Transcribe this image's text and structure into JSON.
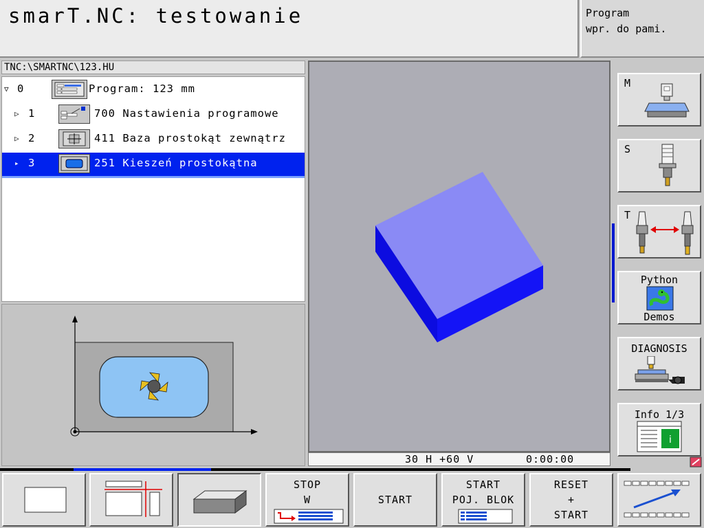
{
  "header": {
    "title": "smarT.NC: testowanie",
    "mode_line1": "Program",
    "mode_line2": "wpr. do pami."
  },
  "tree": {
    "path": "TNC:\\SMARTNC\\123.HU",
    "rows": [
      {
        "num": "0",
        "label": "Program: 123 mm"
      },
      {
        "num": "1",
        "label": "700 Nastawienia programowe"
      },
      {
        "num": "2",
        "label": "411 Baza prostokąt zewnątrz"
      },
      {
        "num": "3",
        "label": "251 Kieszeń prostokątna"
      }
    ],
    "selected_index": 3
  },
  "view": {
    "angle": "30 H +60 V",
    "time": "0:00:00"
  },
  "vertical_softkeys": [
    {
      "key": "M",
      "icon": "machine-table-icon"
    },
    {
      "key": "S",
      "icon": "spindle-icon"
    },
    {
      "key": "T",
      "icon": "tool-change-icon"
    },
    {
      "line1": "Python",
      "line2": "Demos",
      "icon": "python-icon"
    },
    {
      "line1": "DIAGNOSIS",
      "icon": "diagnosis-icon"
    },
    {
      "line1": "Info 1/3",
      "icon": "info-icon"
    }
  ],
  "horizontal_softkeys": [
    {
      "icon": "blank-view-icon"
    },
    {
      "icon": "split-view-icon"
    },
    {
      "icon": "3d-block-icon"
    },
    {
      "line1": "STOP",
      "line2": "W",
      "icon": "program-icon"
    },
    {
      "line1": "START"
    },
    {
      "line1": "START",
      "line2": "POJ. BLOK",
      "icon": "program-icon"
    },
    {
      "line1": "RESET",
      "line2": "+",
      "line3": "START"
    },
    {
      "icon": "softkey-switch-icon"
    }
  ],
  "colors": {
    "selection": "#0022ee",
    "workpiece_top": "#8a8af5",
    "workpiece_side": "#1010f0",
    "pocket": "#8ec4f4"
  }
}
